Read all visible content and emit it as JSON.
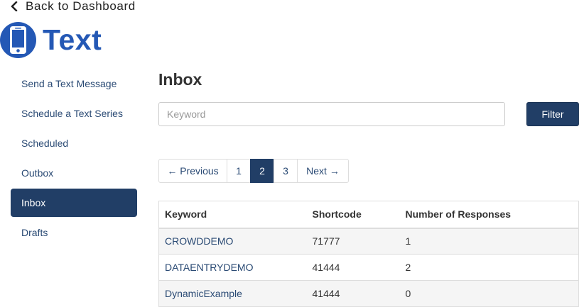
{
  "nav": {
    "back_label": "Back to Dashboard"
  },
  "brand": {
    "title": "Text",
    "icon": "phone-icon",
    "color": "#2458b5"
  },
  "sidebar": {
    "items": [
      {
        "label": "Send a Text Message",
        "active": false
      },
      {
        "label": "Schedule a Text Series",
        "active": false
      },
      {
        "label": "Scheduled",
        "active": false
      },
      {
        "label": "Outbox",
        "active": false
      },
      {
        "label": "Inbox",
        "active": true
      },
      {
        "label": "Drafts",
        "active": false
      }
    ],
    "active_color": "#213e66"
  },
  "main": {
    "title": "Inbox",
    "search": {
      "placeholder": "Keyword",
      "value": ""
    },
    "filter_label": "Filter",
    "pagination": {
      "prev_label": "← Previous",
      "pages": [
        "1",
        "2",
        "3"
      ],
      "current_page": "2",
      "next_label": "Next →"
    },
    "table": {
      "headers": [
        "Keyword",
        "Shortcode",
        "Number of Responses"
      ],
      "rows": [
        [
          "CROWDDEMO",
          "71777",
          "1"
        ],
        [
          "DATAENTRYDEMO",
          "41444",
          "2"
        ],
        [
          "DynamicExample",
          "41444",
          "0"
        ]
      ]
    }
  }
}
